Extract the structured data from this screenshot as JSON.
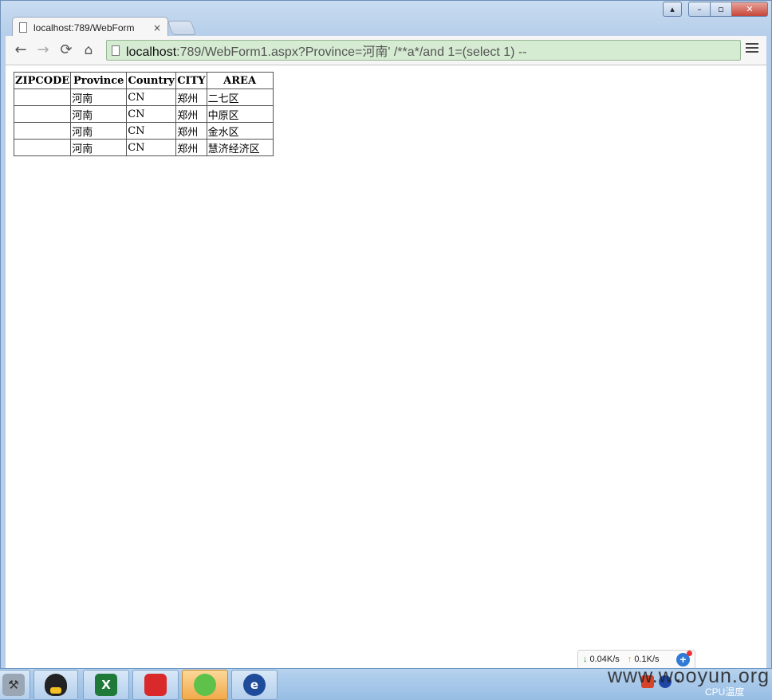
{
  "tab": {
    "title": "localhost:789/WebForm",
    "close": "×"
  },
  "toolbar": {
    "back": "←",
    "forward": "→",
    "reload": "⟳",
    "home": "⌂"
  },
  "address": {
    "host": "localhost",
    "rest": ":789/WebForm1.aspx?Province=河南'   /**a*/and 1=(select 1) --"
  },
  "table": {
    "headers": [
      "ZIPCODE",
      "Province",
      "Country",
      "CITY",
      "AREA"
    ],
    "rows": [
      [
        "",
        "河南",
        "CN",
        "郑州",
        "二七区"
      ],
      [
        "",
        "河南",
        "CN",
        "郑州",
        "中原区"
      ],
      [
        "",
        "河南",
        "CN",
        "郑州",
        "金水区"
      ],
      [
        "",
        "河南",
        "CN",
        "郑州",
        "慧济经济区"
      ]
    ]
  },
  "network": {
    "down": "0.04K/s",
    "up": "0.1K/s",
    "down_icon": "↓",
    "up_icon": "↑",
    "plus": "+"
  },
  "taskbar": {
    "excel_glyph": "X",
    "ie_glyph": "e"
  },
  "tray": {
    "cpu_label": "CPU温度"
  },
  "watermark": "www.wooyun.org",
  "window": {
    "min": "–",
    "max": "▫",
    "close": "✕",
    "user": "▴"
  }
}
